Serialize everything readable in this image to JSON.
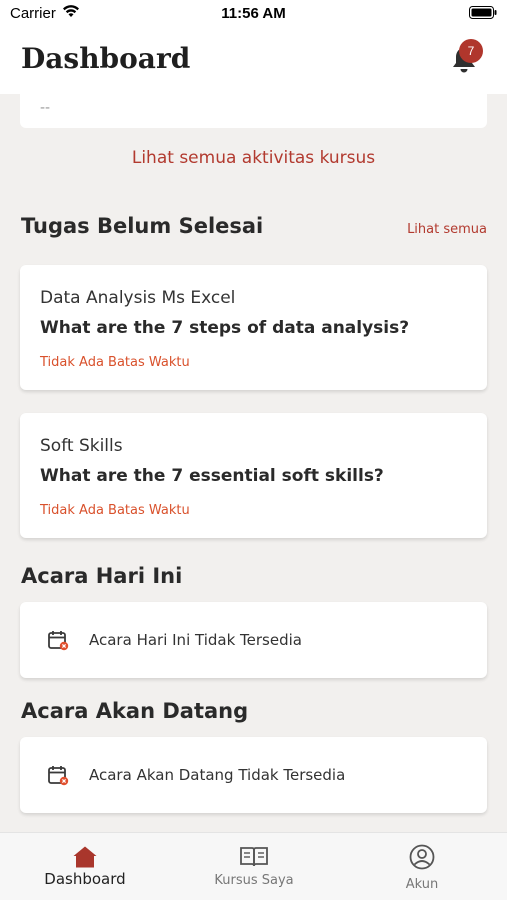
{
  "status": {
    "carrier": "Carrier",
    "time": "11:56 AM"
  },
  "header": {
    "title": "Dashboard",
    "notification_count": "7"
  },
  "activity": {
    "empty_value": "--",
    "see_all_link": "Lihat semua aktivitas kursus"
  },
  "tasks": {
    "title": "Tugas Belum Selesai",
    "see_all": "Lihat semua",
    "items": [
      {
        "course": "Data Analysis Ms Excel",
        "question": "What are the 7 steps of data analysis?",
        "deadline": "Tidak Ada Batas Waktu"
      },
      {
        "course": "Soft Skills",
        "question": "What are the 7 essential soft skills?",
        "deadline": "Tidak Ada Batas Waktu"
      }
    ]
  },
  "events_today": {
    "title": "Acara Hari Ini",
    "empty_text": "Acara Hari Ini Tidak Tersedia"
  },
  "events_upcoming": {
    "title": "Acara Akan Datang",
    "empty_text": "Acara Akan Datang Tidak Tersedia"
  },
  "tabbar": {
    "items": [
      {
        "label": "Dashboard",
        "icon": "home-icon",
        "active": true
      },
      {
        "label": "Kursus Saya",
        "icon": "book-icon",
        "active": false
      },
      {
        "label": "Akun",
        "icon": "account-icon",
        "active": false
      }
    ]
  },
  "colors": {
    "accent": "#b23a2f",
    "deadline": "#d9512c",
    "background": "#f2f0ee"
  }
}
